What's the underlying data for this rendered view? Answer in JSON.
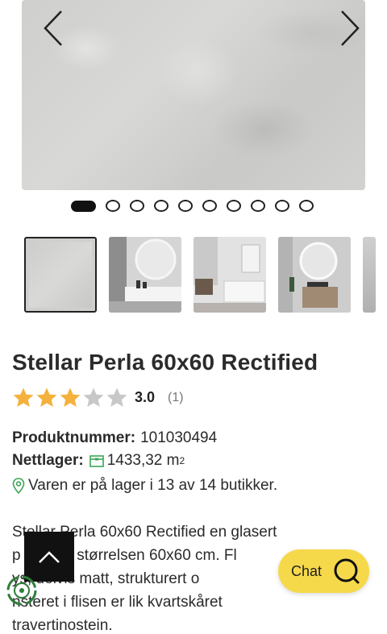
{
  "product": {
    "title": "Stellar Perla 60x60 Rectified",
    "rating_value": "3.0",
    "rating_count": "(1)",
    "rating_stars": 3,
    "rating_max": 5,
    "product_number_label": "Produktnummer:",
    "product_number": "101030494",
    "stock_label": "Nettlager:",
    "stock_value": "1433,32 m",
    "stock_unit_exp": "2",
    "stores_text": "Varen er på lager i 13 av 14 butikker.",
    "description": [
      "Stellar Perla 60x60 Rectified en glasert",
      "p        atoflis i størrelsen 60x60 cm. Fl",
      "       ys, delvis matt, strukturert o",
      "      nsteret i flisen er lik kvartskåret",
      "travertinostein."
    ]
  },
  "gallery": {
    "total_images": 10,
    "current_index": 1,
    "icons": {
      "prev": "chevron-left-icon",
      "next": "chevron-right-icon"
    }
  },
  "thumbnails": [
    {
      "label": "grey tile texture",
      "selected": true
    },
    {
      "label": "bathroom with round mirror",
      "selected": false
    },
    {
      "label": "bathroom with bathtub",
      "selected": false
    },
    {
      "label": "bathroom with illuminated mirror",
      "selected": false
    },
    {
      "label": "partial thumbnail",
      "selected": false
    }
  ],
  "chat": {
    "label": "Chat",
    "icon": "chat-bubble-icon"
  },
  "colors": {
    "star_filled": "#f5b13d",
    "star_empty": "#c8c8c8",
    "chat_bg": "#f6d94a",
    "pin_green": "#3aa655"
  }
}
